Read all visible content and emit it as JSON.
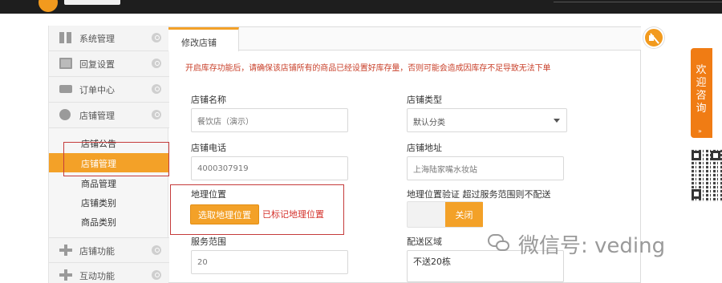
{
  "sidebar": {
    "menu": [
      {
        "label": "系统管理",
        "icon": "grid-icon"
      },
      {
        "label": "回复设置",
        "icon": "mail-icon"
      },
      {
        "label": "订单中心",
        "icon": "truck-icon"
      },
      {
        "label": "店铺管理",
        "icon": "clock-icon"
      }
    ],
    "sub": [
      {
        "label": "店铺公告",
        "active": false
      },
      {
        "label": "店铺管理",
        "active": true
      },
      {
        "label": "商品管理",
        "active": false
      },
      {
        "label": "店铺类别",
        "active": false
      },
      {
        "label": "商品类别",
        "active": false
      }
    ],
    "menu_bottom": [
      {
        "label": "店铺功能",
        "icon": "plus-icon"
      },
      {
        "label": "互动功能",
        "icon": "plus-icon"
      }
    ]
  },
  "tab": {
    "label": "修改店铺"
  },
  "notice": "开启库存功能后，请确保该店铺所有的商品已经设置好库存量，否则可能会造成因库存不足导致无法下单",
  "form": {
    "store_name": {
      "label": "店铺名称",
      "value": "餐饮店（演示）"
    },
    "store_type": {
      "label": "店铺类型",
      "value": "默认分类"
    },
    "store_phone": {
      "label": "店铺电话",
      "value": "4000307919"
    },
    "store_address": {
      "label": "店铺地址",
      "value": "上海陆家嘴水妆站"
    },
    "geo_location": {
      "label": "地理位置",
      "button": "选取地理位置",
      "status": "已标记地理位置"
    },
    "geo_verify": {
      "label": "地理位置验证 超过服务范围则不配送",
      "toggle": "关闭"
    },
    "service_range": {
      "label": "服务范围",
      "value": "20"
    },
    "delivery_area": {
      "label": "配送区域",
      "value": "不送20栋"
    }
  },
  "consult": {
    "label": "欢迎咨询"
  },
  "watermark": "微信号: veding",
  "colors": {
    "accent": "#f3a128",
    "notice": "#c9412b",
    "highlight": "#c53b3b",
    "consult": "#f07c14"
  }
}
